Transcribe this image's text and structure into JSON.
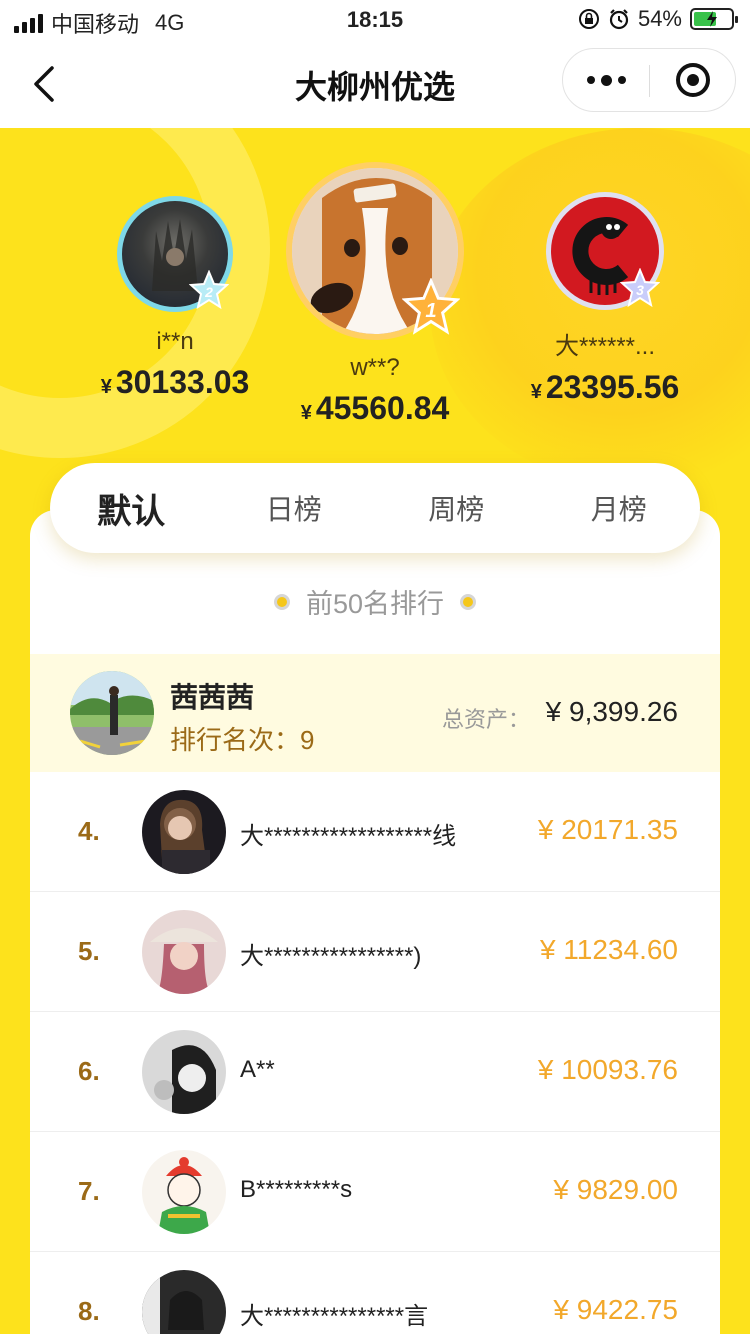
{
  "status_bar": {
    "carrier": "中国移动",
    "network": "4G",
    "time": "18:15",
    "battery": "54%"
  },
  "nav": {
    "title": "大柳州优选"
  },
  "podium": [
    {
      "rank": "2",
      "name": "i**n",
      "currency": "¥",
      "amount": "30133.03"
    },
    {
      "rank": "1",
      "name": "w**?",
      "currency": "¥",
      "amount": "45560.84"
    },
    {
      "rank": "3",
      "name": "大******...",
      "currency": "¥",
      "amount": "23395.56"
    }
  ],
  "tabs": [
    {
      "label": "默认",
      "active": true
    },
    {
      "label": "日榜",
      "active": false
    },
    {
      "label": "周榜",
      "active": false
    },
    {
      "label": "月榜",
      "active": false
    }
  ],
  "section_title": "前50名排行",
  "me": {
    "name": "茜茜茜",
    "rank_label": "排行名次：9",
    "asset_label": "总资产：",
    "asset": "¥ 9,399.26"
  },
  "list": [
    {
      "rank": "4.",
      "name": "大******************线",
      "amount": "¥ 20171.35"
    },
    {
      "rank": "5.",
      "name": "大****************)",
      "amount": "¥ 11234.60"
    },
    {
      "rank": "6.",
      "name": "A**",
      "amount": "¥ 10093.76"
    },
    {
      "rank": "7.",
      "name": "B*********s",
      "amount": "¥ 9829.00"
    },
    {
      "rank": "8.",
      "name": "大***************言",
      "amount": "¥ 9422.75"
    }
  ],
  "colors": {
    "background": "#fde21c",
    "amount": "#f2a82b",
    "rank": "#9b6a17",
    "me_row": "#fffbe0"
  }
}
